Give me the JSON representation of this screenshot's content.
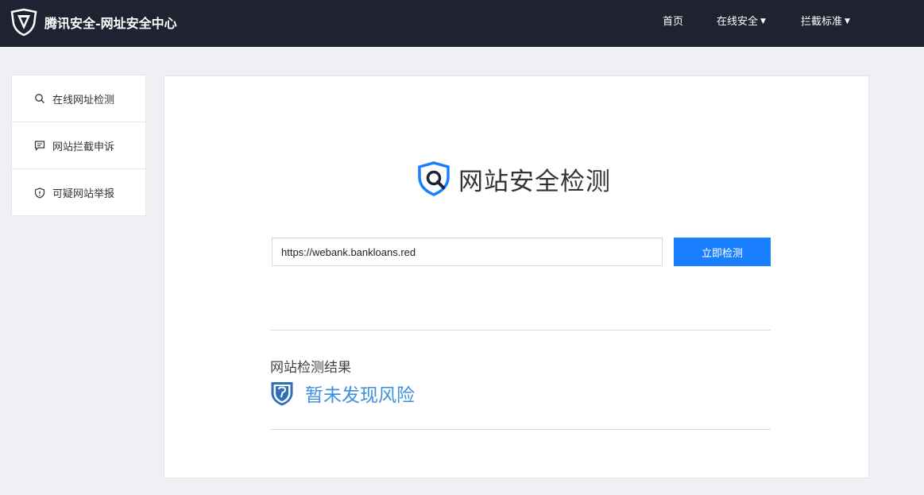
{
  "header": {
    "brand": "腾讯安全-网址安全中心",
    "nav": [
      {
        "label": "首页",
        "has_caret": false
      },
      {
        "label": "在线安全",
        "has_caret": true
      },
      {
        "label": "拦截标准",
        "has_caret": true
      }
    ]
  },
  "sidebar": {
    "items": [
      {
        "label": "在线网址检测",
        "icon": "search-icon"
      },
      {
        "label": "网站拦截申诉",
        "icon": "comment-icon"
      },
      {
        "label": "可疑网站举报",
        "icon": "alert-shield-icon"
      }
    ]
  },
  "main": {
    "title": "网站安全检测",
    "url_value": "https://webank.bankloans.red",
    "check_button": "立即检测",
    "result_label": "网站检测结果",
    "result_text": "暂未发现风险"
  },
  "colors": {
    "header_bg": "#1f2230",
    "accent": "#1a7fff",
    "result_text": "#3d8fe0"
  }
}
